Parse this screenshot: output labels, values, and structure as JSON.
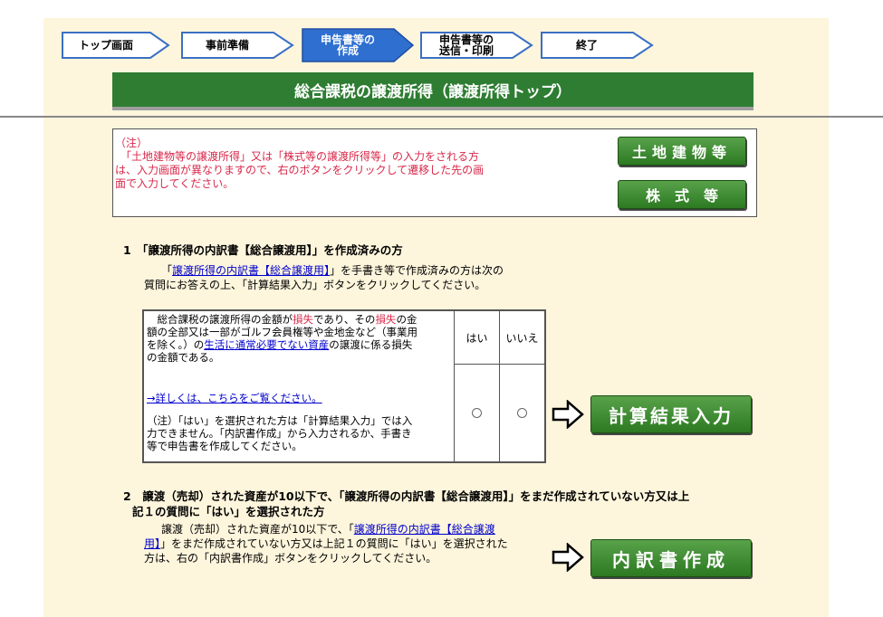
{
  "steps": [
    {
      "label": "トップ画面",
      "state": "normal"
    },
    {
      "label": "事前準備",
      "state": "normal"
    },
    {
      "label": "申告書等の\n作成",
      "state": "active"
    },
    {
      "label": "申告書等の\n送信・印刷",
      "state": "normal"
    },
    {
      "label": "終了",
      "state": "normal"
    }
  ],
  "page_title": "総合課税の譲渡所得（譲渡所得トップ）",
  "note": {
    "heading": "（注）",
    "lines": [
      "　「土地建物等の譲渡所得」又は「株式等の譲渡所得等」の入力をされる方",
      "は、入力画面が異なりますので、右のボタンをクリックして遷移した先の画",
      "面で入力してください。"
    ]
  },
  "buttons": {
    "land": "土地建物等",
    "stock": "株　式　等",
    "calc": "計算結果入力",
    "breakdown": "内訳書作成"
  },
  "section1": {
    "heading": "1　「譲渡所得の内訳書【総合譲渡用】」を作成済みの方",
    "p_open": "「",
    "p_link": "譲渡所得の内訳書【総合譲渡用】",
    "p_rest1": "」を手書き等で作成済みの方は次の",
    "p_line2": "質問にお答えの上、「計算結果入力」ボタンをクリックしてください。"
  },
  "question": {
    "l1a": "　総合課税の譲渡所得の金額が",
    "l1b": "損失",
    "l1c": "であり、その",
    "l1d": "損失",
    "l1e": "の金",
    "l2": "額の全部又は一部がゴルフ会員権等や金地金など（事業用",
    "l3a": "を除く。）の",
    "l3b": "生活に通常必要でない資産",
    "l3c": "の譲渡に係る損失",
    "l4": "の金額である。",
    "detail_link": "→詳しくは、こちらをご覧ください。",
    "n1": "（注）「はい」を選択された方は「計算結果入力」では入",
    "n2": "力できません。「内訳書作成」から入力されるか、手書き",
    "n3": "等で申告書を作成してください。",
    "yes": "はい",
    "no": "いいえ"
  },
  "section2": {
    "heading1": "2　譲渡（売却）された資産が10以下で、「譲渡所得の内訳書【総合譲渡用】」をまだ作成されていない方又は上",
    "heading2": "記１の質問に「はい」を選択された方",
    "p1a": "譲渡（売却）された資産が10以下で、「",
    "p1b": "譲渡所得の内訳書【総合譲渡",
    "p2a": "用】",
    "p2b": "」をまだ作成されていない方又は上記１の質問に「はい」を選択された",
    "p3": "方は、右の「内訳書作成」ボタンをクリックしてください。"
  }
}
